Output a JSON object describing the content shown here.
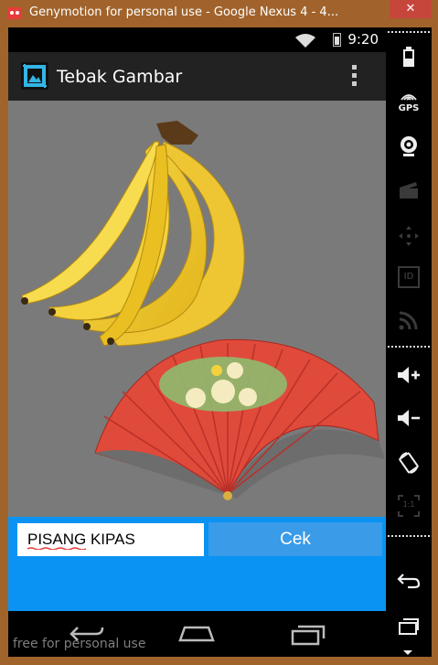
{
  "window": {
    "title": "Genymotion for personal use - Google Nexus 4 - 4...",
    "close_glyph": "✕"
  },
  "status_bar": {
    "time": "9:20"
  },
  "app": {
    "title": "Tebak Gambar",
    "menu_icon": "overflow-menu-icon"
  },
  "puzzle": {
    "images": [
      "banana-bunch",
      "folding-fan"
    ]
  },
  "answer": {
    "value": "PISANG KIPAS",
    "button_label": "Cek"
  },
  "nav": {
    "icons": [
      "back-icon",
      "home-icon",
      "recent-apps-icon"
    ]
  },
  "watermark": "free for personal use",
  "sidebar": {
    "icons": [
      "battery-icon",
      "gps-icon",
      "camera-icon",
      "video-capture-icon",
      "dpad-icon",
      "device-id-icon",
      "network-icon",
      "volume-up-icon",
      "volume-down-icon",
      "rotate-icon",
      "pixel-perfect-icon",
      "back-icon",
      "recent-apps-icon",
      "menu-icon"
    ],
    "gps_label": "GPS",
    "id_label": "ID",
    "scale_label": "1:1"
  },
  "colors": {
    "accent": "#0a93f2",
    "button": "#3a9be8",
    "window_frame": "#a0632a",
    "close": "#c7463c"
  }
}
